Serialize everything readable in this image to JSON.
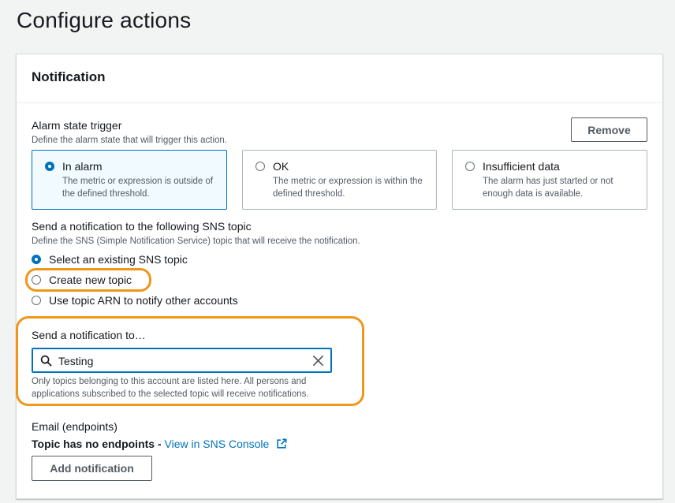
{
  "page": {
    "title": "Configure actions"
  },
  "notification": {
    "header": "Notification",
    "remove_label": "Remove",
    "trigger": {
      "label": "Alarm state trigger",
      "description": "Define the alarm state that will trigger this action.",
      "options": [
        {
          "title": "In alarm",
          "desc": "The metric or expression is outside of the defined threshold.",
          "selected": true
        },
        {
          "title": "OK",
          "desc": "The metric or expression is within the defined threshold.",
          "selected": false
        },
        {
          "title": "Insufficient data",
          "desc": "The alarm has just started or not enough data is available.",
          "selected": false
        }
      ]
    },
    "sns": {
      "label": "Send a notification to the following SNS topic",
      "description": "Define the SNS (Simple Notification Service) topic that will receive the notification.",
      "options": [
        {
          "label": "Select an existing SNS topic",
          "selected": true
        },
        {
          "label": "Create new topic",
          "selected": false
        },
        {
          "label": "Use topic ARN to notify other accounts",
          "selected": false
        }
      ]
    },
    "send_to": {
      "label": "Send a notification to…",
      "search_value": "Testing",
      "hint": "Only topics belonging to this account are listed here. All persons and applications subscribed to the selected topic will receive notifications."
    },
    "email": {
      "label": "Email (endpoints)",
      "no_endpoints": "Topic has no endpoints - ",
      "console_link": "View in SNS Console"
    },
    "add_notification_label": "Add notification"
  },
  "colors": {
    "accent": "#0073bb",
    "highlight": "#f0961b"
  }
}
